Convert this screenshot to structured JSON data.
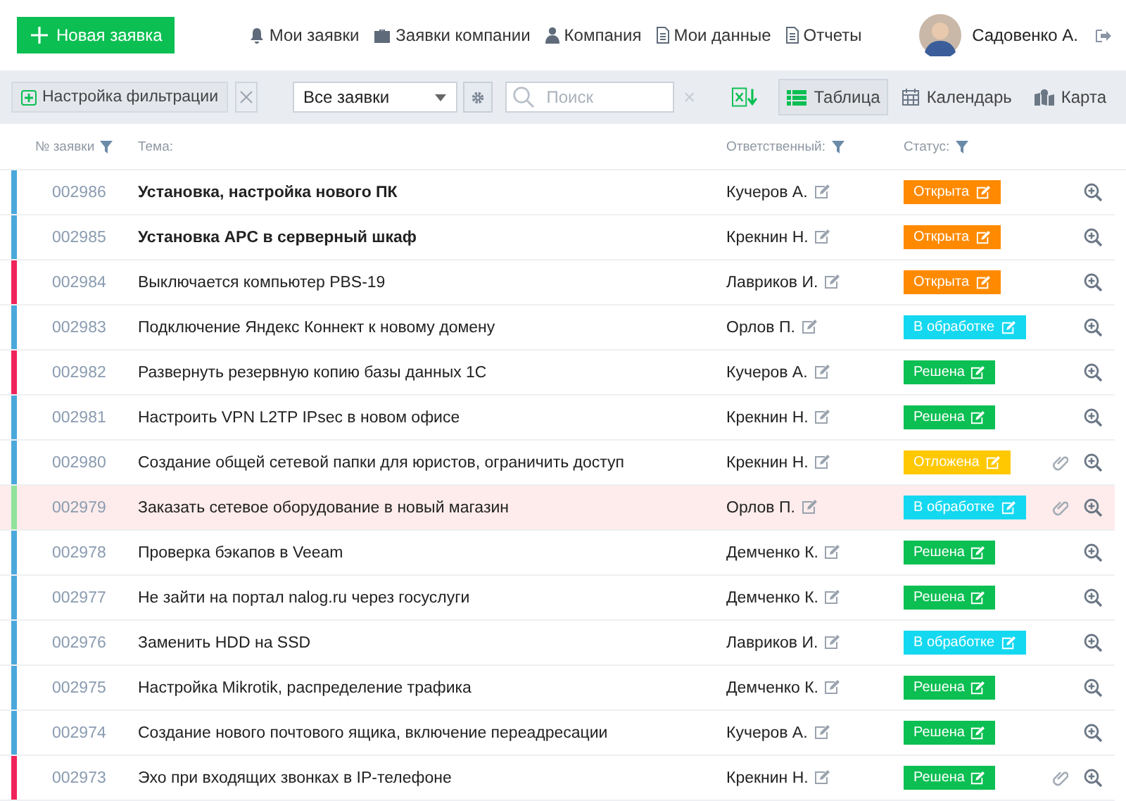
{
  "header": {
    "new_button": "Новая заявка",
    "nav": [
      "Мои заявки",
      "Заявки компании",
      "Компания",
      "Мои данные",
      "Отчеты"
    ],
    "user": "Садовенко А."
  },
  "toolbar": {
    "filter_button": "Настройка фильтрации",
    "filter_select": "Все заявки",
    "search": {
      "placeholder": "Поиск"
    },
    "views": [
      {
        "label": "Таблица",
        "selected": true
      },
      {
        "label": "Календарь",
        "selected": false
      },
      {
        "label": "Карта",
        "selected": false
      }
    ]
  },
  "table": {
    "columns": [
      "№ заявки",
      "Тема:",
      "Ответственный:",
      "Статус:"
    ],
    "rows": [
      {
        "id": "002986",
        "subject": "Установка, настройка нового ПК",
        "unread": true,
        "assignee": "Кучеров А.",
        "status": {
          "label": "Открыта",
          "color": "#ff8a00"
        },
        "color": "#4aa8db",
        "attachment": false,
        "selected": false
      },
      {
        "id": "002985",
        "subject": "Установка APC в серверный шкаф",
        "unread": true,
        "assignee": "Крекнин Н.",
        "status": {
          "label": "Открыта",
          "color": "#ff8a00"
        },
        "color": "#4aa8db",
        "attachment": false,
        "selected": false
      },
      {
        "id": "002984",
        "subject": "Выключается компьютер PBS-19",
        "unread": false,
        "assignee": "Лавриков И.",
        "status": {
          "label": "Открыта",
          "color": "#ff8a00"
        },
        "color": "#f0245a",
        "attachment": false,
        "selected": false
      },
      {
        "id": "002983",
        "subject": "Подключение Яндекс Коннект к новому домену",
        "unread": false,
        "assignee": "Орлов П.",
        "status": {
          "label": "В обработке",
          "color": "#14d8f0"
        },
        "color": "#4aa8db",
        "attachment": false,
        "selected": false
      },
      {
        "id": "002982",
        "subject": "Развернуть резервную копию базы данных 1С",
        "unread": false,
        "assignee": "Кучеров А.",
        "status": {
          "label": "Решена",
          "color": "#0bbf52"
        },
        "color": "#f0245a",
        "attachment": false,
        "selected": false
      },
      {
        "id": "002981",
        "subject": "Настроить VPN L2TP IPsec в новом офисе",
        "unread": false,
        "assignee": "Крекнин Н.",
        "status": {
          "label": "Решена",
          "color": "#0bbf52"
        },
        "color": "#4aa8db",
        "attachment": false,
        "selected": false
      },
      {
        "id": "002980",
        "subject": "Создание общей сетевой папки для юристов, ограничить доступ",
        "unread": false,
        "assignee": "Крекнин Н.",
        "status": {
          "label": "Отложена",
          "color": "#ffc800"
        },
        "color": "#4aa8db",
        "attachment": true,
        "selected": false
      },
      {
        "id": "002979",
        "subject": "Заказать сетевое оборудование в новый магазин",
        "unread": false,
        "assignee": "Орлов П.",
        "status": {
          "label": "В обработке",
          "color": "#14d8f0"
        },
        "color": "#8fe39a",
        "attachment": true,
        "selected": true
      },
      {
        "id": "002978",
        "subject": "Проверка бэкапов в Veeam",
        "unread": false,
        "assignee": "Демченко К.",
        "status": {
          "label": "Решена",
          "color": "#0bbf52"
        },
        "color": "#4aa8db",
        "attachment": false,
        "selected": false
      },
      {
        "id": "002977",
        "subject": "Не зайти на портал nalog.ru через госуслуги",
        "unread": false,
        "assignee": "Демченко К.",
        "status": {
          "label": "Решена",
          "color": "#0bbf52"
        },
        "color": "#4aa8db",
        "attachment": false,
        "selected": false
      },
      {
        "id": "002976",
        "subject": "Заменить HDD на SSD",
        "unread": false,
        "assignee": "Лавриков И.",
        "status": {
          "label": "В обработке",
          "color": "#14d8f0"
        },
        "color": "#4aa8db",
        "attachment": false,
        "selected": false
      },
      {
        "id": "002975",
        "subject": "Настройка Mikrotik, распределение трафика",
        "unread": false,
        "assignee": "Демченко К.",
        "status": {
          "label": "Решена",
          "color": "#0bbf52"
        },
        "color": "#4aa8db",
        "attachment": false,
        "selected": false
      },
      {
        "id": "002974",
        "subject": "Создание нового почтового ящика, включение переадресации",
        "unread": false,
        "assignee": "Кучеров А.",
        "status": {
          "label": "Решена",
          "color": "#0bbf52"
        },
        "color": "#4aa8db",
        "attachment": false,
        "selected": false
      },
      {
        "id": "002973",
        "subject": "Эхо при входящих звонках в IP-телефоне",
        "unread": false,
        "assignee": "Крекнин Н.",
        "status": {
          "label": "Решена",
          "color": "#0bbf52"
        },
        "color": "#f0245a",
        "attachment": true,
        "selected": false
      }
    ]
  }
}
